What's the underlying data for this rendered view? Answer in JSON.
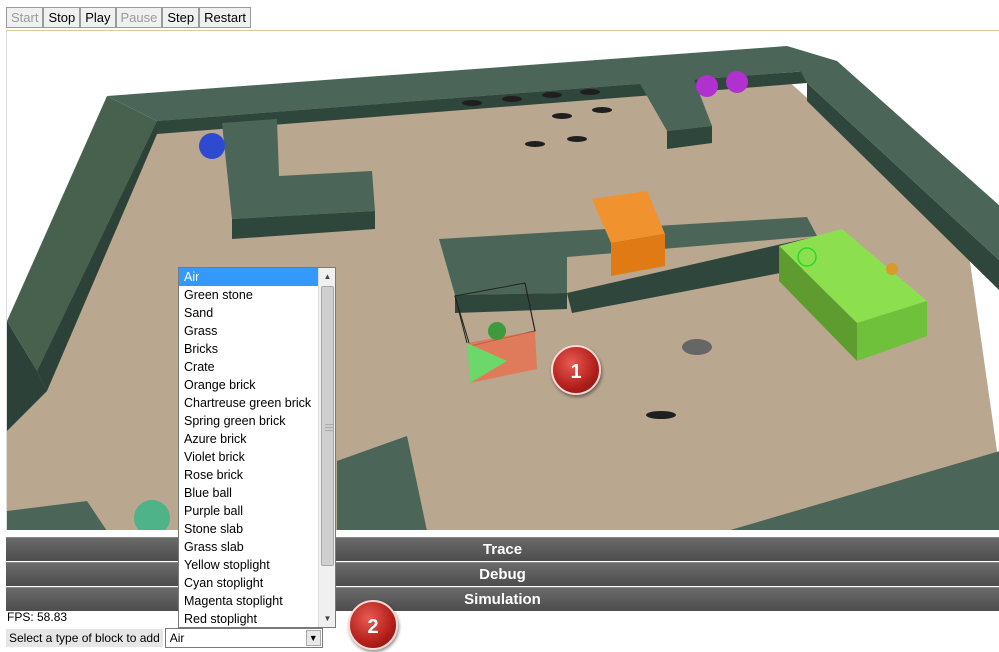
{
  "toolbar": {
    "buttons": [
      {
        "label": "Start",
        "enabled": false
      },
      {
        "label": "Stop",
        "enabled": true
      },
      {
        "label": "Play",
        "enabled": true
      },
      {
        "label": "Pause",
        "enabled": false
      },
      {
        "label": "Step",
        "enabled": true
      },
      {
        "label": "Restart",
        "enabled": true
      }
    ]
  },
  "panels": [
    "Trace",
    "Debug",
    "Simulation"
  ],
  "status": {
    "fps": "FPS: 58.83"
  },
  "block_selector": {
    "label": "Select a type of block to add",
    "selected": "Air",
    "options": [
      "Air",
      "Green stone",
      "Sand",
      "Grass",
      "Bricks",
      "Crate",
      "Orange brick",
      "Chartreuse green brick",
      "Spring green brick",
      "Azure brick",
      "Violet brick",
      "Rose brick",
      "Blue ball",
      "Purple ball",
      "Stone slab",
      "Grass slab",
      "Yellow stoplight",
      "Cyan stoplight",
      "Magenta stoplight",
      "Red stoplight"
    ]
  },
  "markers": [
    "1",
    "2"
  ],
  "colors": {
    "wall": "#3f5a4e",
    "floor": "#b8a68e",
    "crate": "#f0922d",
    "green_block": "#7fd84a",
    "selected_item": "#3399ff"
  }
}
